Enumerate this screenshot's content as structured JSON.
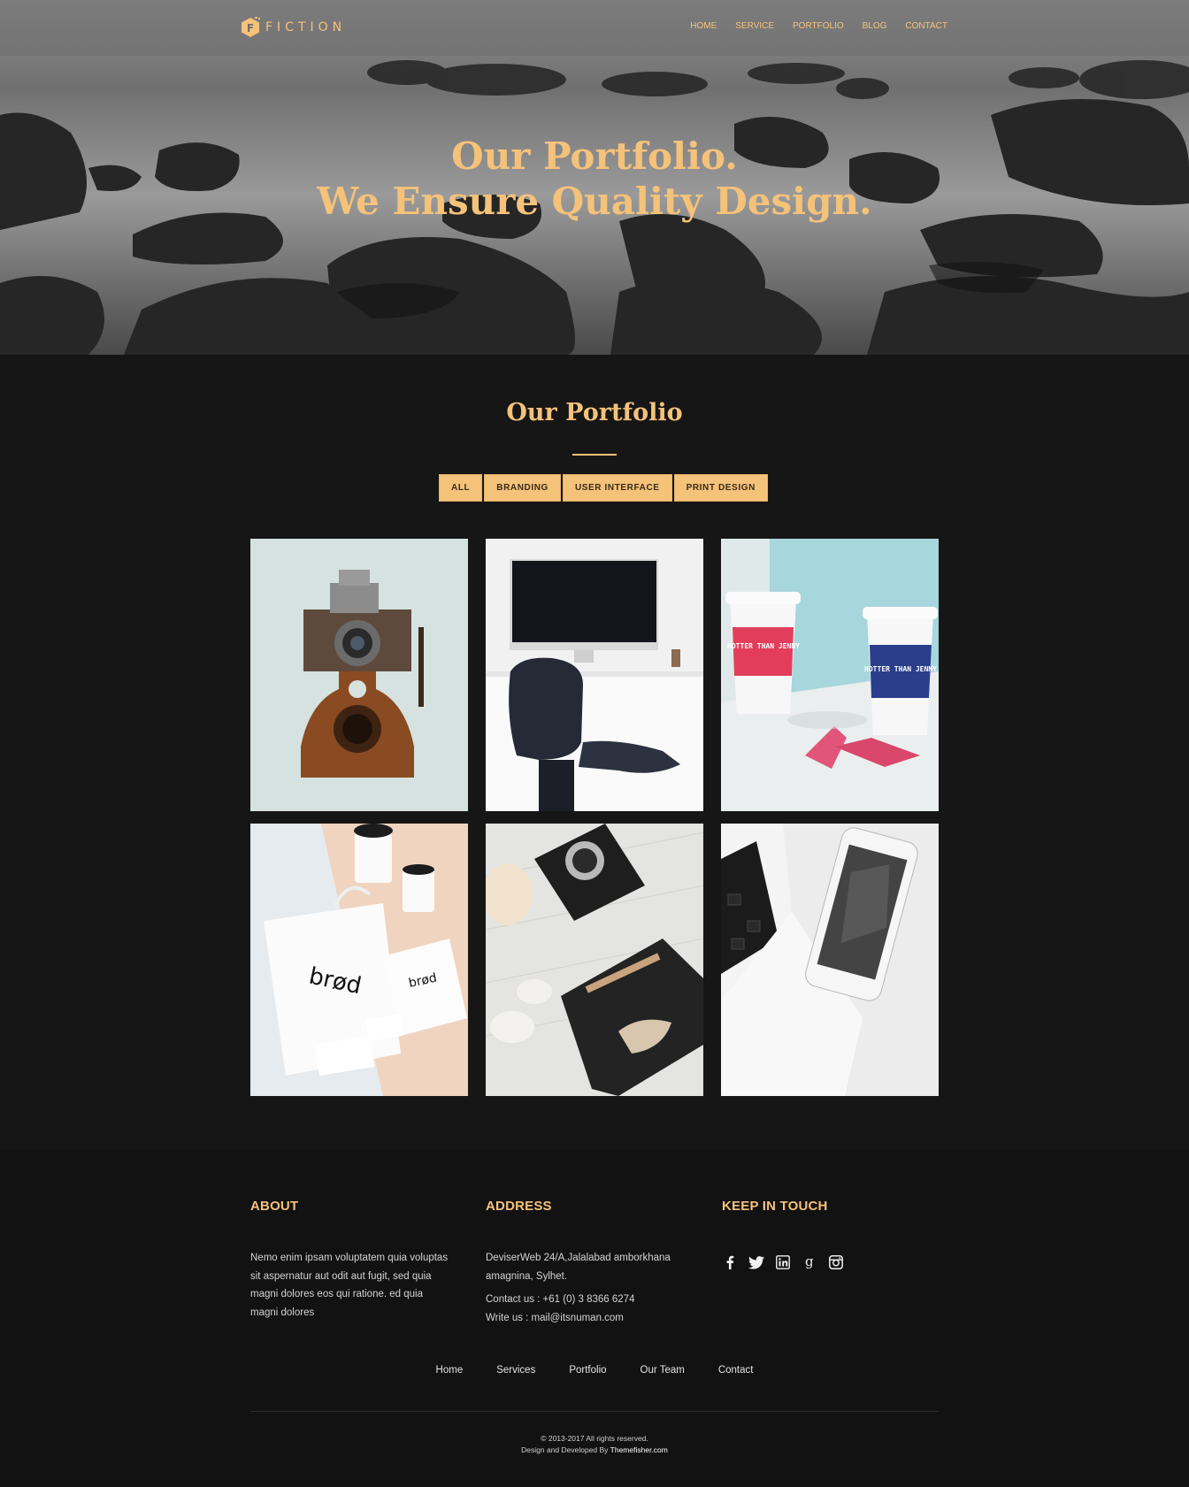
{
  "brand": {
    "name": "FICTION",
    "logo_letter": "F",
    "accent": "#f5c27a"
  },
  "nav": {
    "items": [
      {
        "label": "HOME"
      },
      {
        "label": "SERVICE"
      },
      {
        "label": "PORTFOLIO"
      },
      {
        "label": "BLOG"
      },
      {
        "label": "CONTACT"
      }
    ]
  },
  "hero": {
    "line1": "Our Portfolio.",
    "line2": "We Ensure Quality Design."
  },
  "portfolio": {
    "title": "Our Portfolio",
    "filters": [
      {
        "label": "ALL"
      },
      {
        "label": "BRANDING"
      },
      {
        "label": "USER INTERFACE"
      },
      {
        "label": "PRINT DESIGN"
      }
    ],
    "items": [
      {
        "image": "vintage-camera-photo",
        "print_1": "",
        "print_2": ""
      },
      {
        "image": "desk-computer-chair-photo",
        "print_1": "",
        "print_2": ""
      },
      {
        "image": "coffee-cups-photo",
        "print_1": "HOTTER THAN JENNY",
        "print_2": "HOTTER THAN JENNY"
      },
      {
        "image": "brød-branding-mockup-photo",
        "print_1": "brød",
        "print_2": "brød"
      },
      {
        "image": "camera-notebook-desk-photo",
        "print_1": "",
        "print_2": ""
      },
      {
        "image": "laptop-smartphone-photo",
        "print_1": "",
        "print_2": ""
      }
    ]
  },
  "footer": {
    "about": {
      "heading": "ABOUT",
      "text_lines": [
        "Nemo enim ipsam voluptatem quia voluptas",
        "sit aspernatur aut odit aut fugit, sed quia",
        "magni dolores eos qui ratione. ed quia",
        "magni dolores"
      ]
    },
    "address": {
      "heading": "ADDRESS",
      "line1": "DeviserWeb 24/A,Jalalabad amborkhana",
      "line2": "amagnina, Sylhet.",
      "contact": "Contact us : +61 (0) 3 8366 6274",
      "email": "Write us : mail@itsnuman.com"
    },
    "social": {
      "heading": "KEEP IN TOUCH",
      "icons": [
        "facebook-icon",
        "twitter-icon",
        "linkedin-icon",
        "google-plus-icon",
        "instagram-icon"
      ]
    },
    "links": [
      {
        "label": "Home"
      },
      {
        "label": "Services"
      },
      {
        "label": "Portfolio"
      },
      {
        "label": "Our Team"
      },
      {
        "label": "Contact"
      }
    ],
    "copyright": "© 2013-2017 All rights reserved.",
    "credit_prefix": "Design and Developed By",
    "credit_name": "Themefisher.com"
  }
}
